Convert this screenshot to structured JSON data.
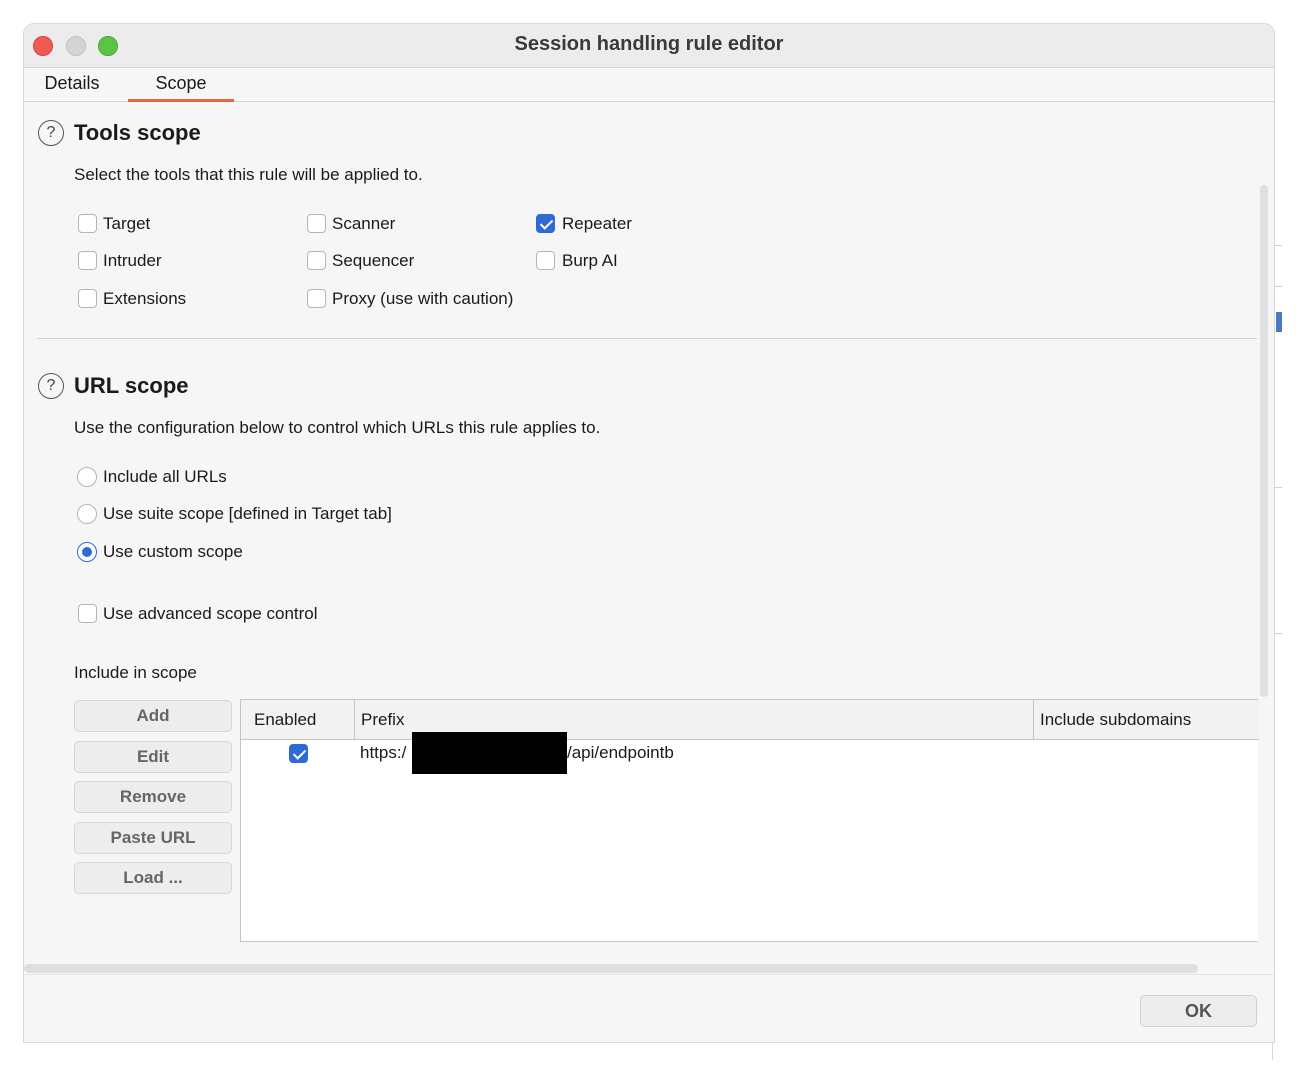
{
  "window": {
    "title": "Session handling rule editor"
  },
  "tabs": [
    {
      "label": "Details",
      "active": false
    },
    {
      "label": "Scope",
      "active": true
    }
  ],
  "tools_scope": {
    "heading": "Tools scope",
    "description": "Select the tools that this rule will be applied to.",
    "tools": [
      {
        "label": "Target",
        "checked": false
      },
      {
        "label": "Scanner",
        "checked": false
      },
      {
        "label": "Repeater",
        "checked": true
      },
      {
        "label": "Intruder",
        "checked": false
      },
      {
        "label": "Sequencer",
        "checked": false
      },
      {
        "label": "Burp AI",
        "checked": false
      },
      {
        "label": "Extensions",
        "checked": false
      },
      {
        "label": "Proxy (use with caution)",
        "checked": false
      }
    ]
  },
  "url_scope": {
    "heading": "URL scope",
    "description": "Use the configuration below to control which URLs this rule applies to.",
    "options": [
      {
        "label": "Include all URLs",
        "selected": false
      },
      {
        "label": "Use suite scope [defined in Target tab]",
        "selected": false
      },
      {
        "label": "Use custom scope",
        "selected": true
      }
    ],
    "advanced": {
      "label": "Use advanced scope control",
      "checked": false
    },
    "include_label": "Include in scope",
    "buttons": [
      "Add",
      "Edit",
      "Remove",
      "Paste URL",
      "Load ..."
    ],
    "table": {
      "columns": [
        "Enabled",
        "Prefix",
        "Include subdomains"
      ],
      "rows": [
        {
          "enabled": true,
          "prefix_start": "https:/",
          "prefix_end": "/api/endpointb",
          "include_subdomains": ""
        }
      ]
    }
  },
  "footer": {
    "ok_label": "OK"
  },
  "colors": {
    "accent": "#2e6ad6",
    "tab_underline": "#e8663c"
  }
}
